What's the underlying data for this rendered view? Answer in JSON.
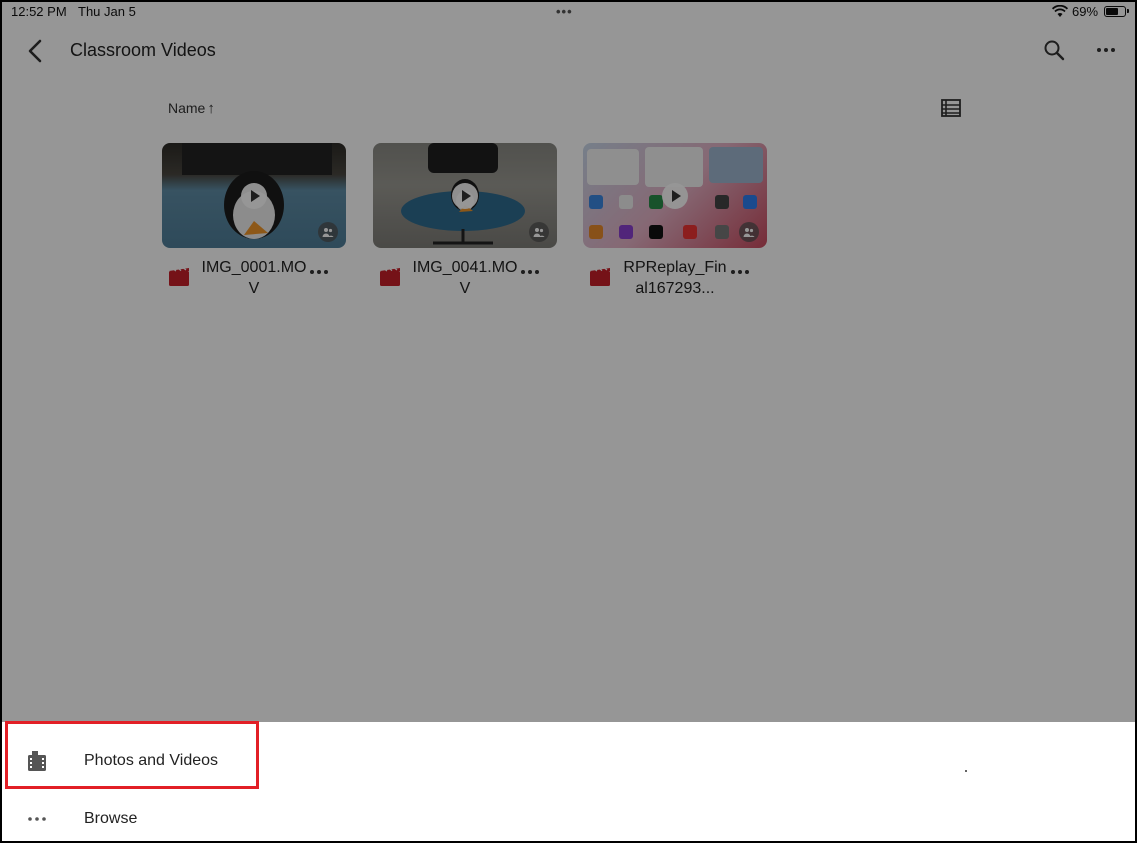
{
  "status_bar": {
    "time": "12:52 PM",
    "date": "Thu Jan 5",
    "multitask": "•••",
    "battery_percent": "69%",
    "battery_level": 0.69
  },
  "app_bar": {
    "title": "Classroom Videos",
    "back_icon": "chevron-left-icon",
    "search_icon": "search-icon",
    "more_icon": "more-horizontal-icon"
  },
  "toolbar": {
    "sort_label": "Name",
    "sort_arrow": "↑",
    "view_icon": "list-view-icon"
  },
  "files": [
    {
      "name": "IMG_0001.MOV",
      "type_icon": "video-file-icon",
      "shared": true
    },
    {
      "name": "IMG_0041.MOV",
      "type_icon": "video-file-icon",
      "shared": true
    },
    {
      "name": "RPReplay_Final167293...",
      "type_icon": "video-file-icon",
      "shared": true
    }
  ],
  "sheet": {
    "items": [
      {
        "label": "Photos and Videos",
        "icon": "film-roll-icon"
      },
      {
        "label": "Browse",
        "icon": "more-horizontal-icon"
      }
    ]
  },
  "colors": {
    "video_icon_red": "#c8202a",
    "highlight_red": "#e21f26"
  }
}
